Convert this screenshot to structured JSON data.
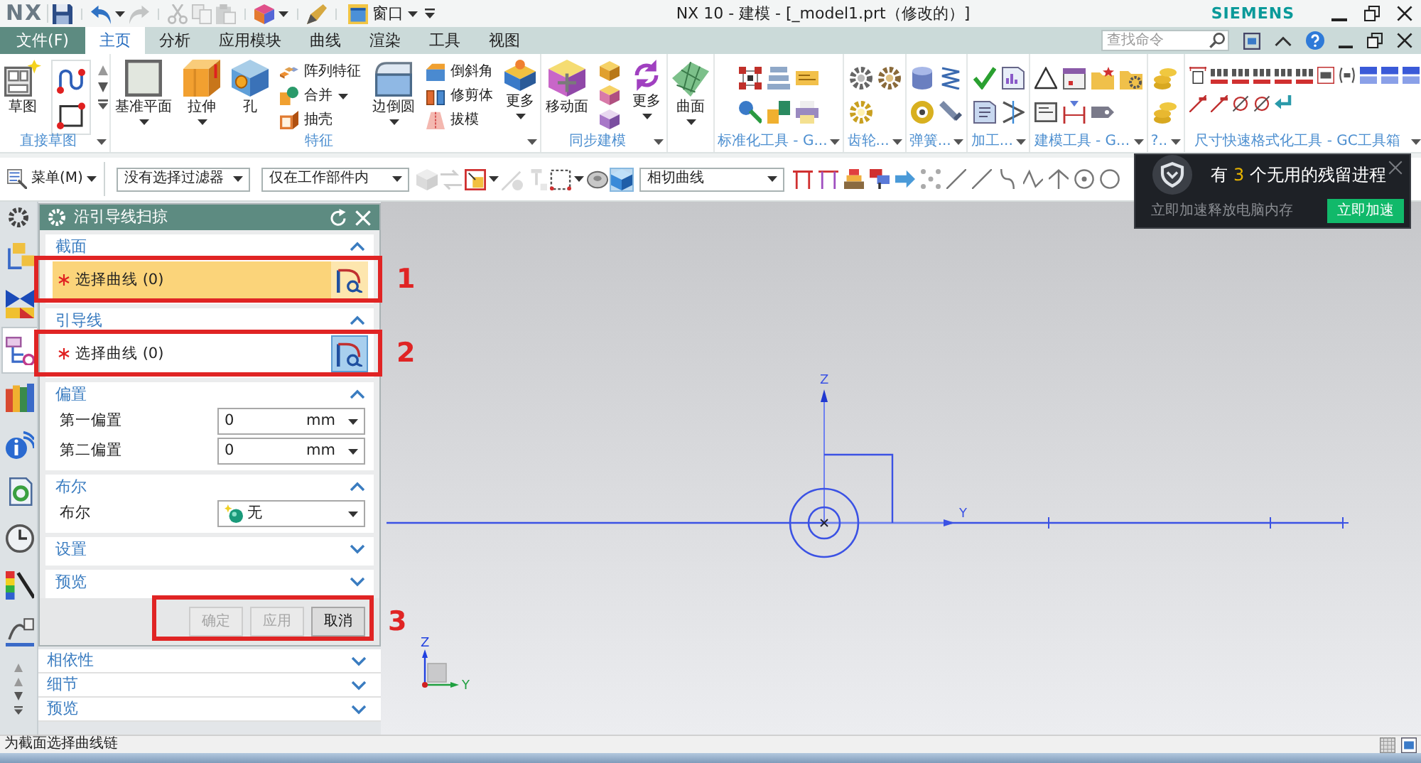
{
  "title_bar": {
    "logo": "NX",
    "window_menu": "窗口",
    "title": "NX 10 - 建模 - [_model1.prt（修改的）]",
    "brand": "SIEMENS"
  },
  "quick_access": [
    {
      "disabled": false
    },
    {
      "disabled": false
    },
    {
      "disabled": true
    },
    {
      "disabled": true
    },
    {
      "disabled": true
    },
    {
      "disabled": true
    },
    {
      "disabled": false
    },
    {
      "disabled": false
    }
  ],
  "tabs": [
    {
      "label": "文件(F)",
      "kind": "file",
      "selected": false
    },
    {
      "label": "主页",
      "kind": "tab",
      "selected": true
    },
    {
      "label": "分析",
      "kind": "tab",
      "selected": false
    },
    {
      "label": "应用模块",
      "kind": "tab",
      "selected": false
    },
    {
      "label": "曲线",
      "kind": "tab",
      "selected": false
    },
    {
      "label": "渲染",
      "kind": "tab",
      "selected": false
    },
    {
      "label": "工具",
      "kind": "tab",
      "selected": false
    },
    {
      "label": "视图",
      "kind": "tab",
      "selected": false
    }
  ],
  "command_search": {
    "placeholder": "查找命令"
  },
  "ribbon_groups": [
    {
      "label": "直接草图",
      "launcher": true,
      "items": [
        {
          "kind": "large",
          "label": "草图",
          "dropdown": false
        },
        {
          "kind": "icons"
        },
        {
          "kind": "icons"
        }
      ]
    },
    {
      "label": "特征",
      "launcher": true,
      "items": [
        {
          "kind": "large",
          "label": "基准平面",
          "dropdown": true
        },
        {
          "kind": "large",
          "label": "拉伸",
          "dropdown": true
        },
        {
          "kind": "large",
          "label": "孔",
          "dropdown": false
        },
        {
          "kind": "small",
          "entries": [
            {
              "label": "阵列特征",
              "dropdown": false
            },
            {
              "label": "合并",
              "dropdown": true
            },
            {
              "label": "抽壳",
              "dropdown": false
            }
          ]
        },
        {
          "kind": "large",
          "label": "边倒圆",
          "dropdown": true
        },
        {
          "kind": "small",
          "entries": [
            {
              "label": "倒斜角",
              "dropdown": false
            },
            {
              "label": "修剪体",
              "dropdown": false
            },
            {
              "label": "拔模",
              "dropdown": false
            }
          ]
        },
        {
          "kind": "large",
          "label": "更多",
          "dropdown": true
        }
      ]
    },
    {
      "label": "同步建模",
      "launcher": true,
      "items": [
        {
          "kind": "large",
          "label": "移动面",
          "dropdown": false
        },
        {
          "kind": "icons"
        },
        {
          "kind": "large",
          "label": "更多",
          "dropdown": true
        }
      ]
    },
    {
      "items": [
        {
          "kind": "large",
          "label": "曲面",
          "dropdown": true
        }
      ]
    },
    {
      "label": "标准化工具 - G...",
      "launcher": true,
      "items": [
        {
          "kind": "icons"
        }
      ]
    },
    {
      "label": "齿轮...",
      "launcher": true,
      "items": [
        {
          "kind": "icons"
        }
      ]
    },
    {
      "label": "弹簧...",
      "launcher": true,
      "items": [
        {
          "kind": "icons"
        }
      ]
    },
    {
      "label": "加工...",
      "launcher": true,
      "items": [
        {
          "kind": "icons"
        }
      ]
    },
    {
      "label": "建模工具 - G...",
      "launcher": true,
      "items": [
        {
          "kind": "icons"
        }
      ]
    },
    {
      "label": "?..",
      "launcher": true,
      "items": [
        {
          "kind": "icons"
        }
      ]
    },
    {
      "label": "尺寸快速格式化工具 - GC工具箱",
      "launcher": true,
      "items": [
        {
          "kind": "icons"
        }
      ]
    }
  ],
  "toolbar": {
    "menu": "菜单(M)",
    "selection_filter": "没有选择过滤器",
    "selection_scope": "仅在工作部件内",
    "curve_rule": "相切曲线",
    "view_icons": [
      {
        "disabled": true,
        "on": false
      },
      {
        "disabled": true,
        "on": false
      },
      {
        "disabled": false,
        "on": false
      },
      {
        "disabled": true,
        "on": false
      },
      {
        "disabled": true,
        "on": false
      },
      {
        "disabled": false,
        "on": false
      },
      {
        "disabled": false,
        "on": false
      },
      {
        "disabled": false,
        "on": true
      }
    ]
  },
  "resource_tabs": [
    {
      "selected": false
    },
    {
      "selected": false
    },
    {
      "selected": true
    },
    {
      "selected": false
    },
    {
      "selected": false
    },
    {
      "selected": false
    },
    {
      "selected": false
    },
    {
      "selected": false
    },
    {
      "selected": false
    }
  ],
  "dialog": {
    "title": "沿引导线扫掠",
    "sections": [
      {
        "title": "截面",
        "expanded": true,
        "rows": [
          {
            "kind": "selection",
            "label": "选择曲线 (0)",
            "required": true,
            "selected": true,
            "annotation": "1"
          }
        ]
      },
      {
        "title": "引导线",
        "expanded": true,
        "rows": [
          {
            "kind": "selection",
            "label": "选择曲线 (0)",
            "required": true,
            "selected": false,
            "annotation": "2"
          }
        ]
      },
      {
        "title": "偏置",
        "expanded": true,
        "rows": [
          {
            "kind": "number",
            "label": "第一偏置",
            "value": "0",
            "unit": "mm"
          },
          {
            "kind": "number",
            "label": "第二偏置",
            "value": "0",
            "unit": "mm"
          }
        ]
      },
      {
        "title": "布尔",
        "expanded": true,
        "rows": [
          {
            "kind": "choice",
            "label": "布尔",
            "value": "无"
          }
        ]
      },
      {
        "title": "设置",
        "expanded": false
      },
      {
        "title": "预览",
        "expanded": false
      }
    ],
    "buttons": [
      {
        "label": "确定",
        "disabled": true
      },
      {
        "label": "应用",
        "disabled": true
      },
      {
        "label": "取消",
        "disabled": false
      }
    ],
    "buttons_annotation": "3"
  },
  "navigator_sections": [
    {
      "title": "相依性",
      "expanded": false
    },
    {
      "title": "细节",
      "expanded": false
    },
    {
      "title": "预览",
      "expanded": false
    }
  ],
  "canvas": {
    "z_label": "Z",
    "y_label": "Y",
    "triad_z_label": "Z",
    "triad_y_label": "Y"
  },
  "notification": {
    "before": "有",
    "count": "3",
    "after": "个无用的残留进程",
    "detail": "立即加速释放电脑内存",
    "action": "立即加速"
  },
  "status_bar": {
    "prompt": "为截面选择曲线链"
  }
}
